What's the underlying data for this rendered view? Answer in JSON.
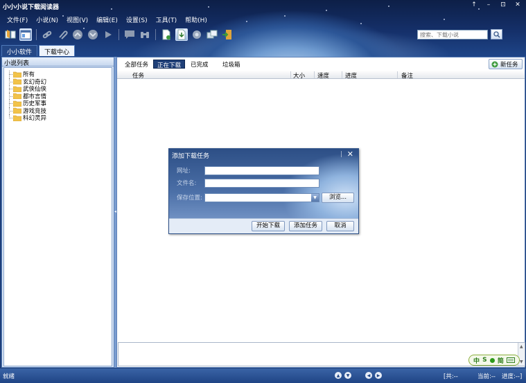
{
  "window": {
    "title": "小小小说下载阅读器",
    "buttons": [
      "↑",
      "–",
      "⊡",
      "✕"
    ]
  },
  "menu": [
    {
      "label": "文件(F)"
    },
    {
      "label": "小说(N)"
    },
    {
      "label": "视图(V)"
    },
    {
      "label": "编辑(E)"
    },
    {
      "label": "设置(S)"
    },
    {
      "label": "工具(T)"
    },
    {
      "label": "帮助(H)"
    }
  ],
  "search": {
    "placeholder": "搜索、下载小说"
  },
  "tabs": [
    {
      "label": "小小软件",
      "selected": false
    },
    {
      "label": "下载中心",
      "selected": true
    }
  ],
  "left_panel": {
    "title": "小说列表",
    "items": [
      "所有",
      "玄幻奇幻",
      "武侠仙侠",
      "都市言情",
      "历史军事",
      "游戏竞技",
      "科幻灵异"
    ]
  },
  "filters": [
    {
      "label": "全部任务",
      "active": false
    },
    {
      "label": "正在下载",
      "active": true
    },
    {
      "label": "已完成",
      "active": false
    },
    {
      "label": "垃圾箱",
      "active": false
    }
  ],
  "new_task_label": "新任务",
  "columns": [
    "任务",
    "大小",
    "速度",
    "进度",
    "备注"
  ],
  "dialog": {
    "title": "添加下载任务",
    "url_label": "网址:",
    "filename_label": "文件名:",
    "save_label": "保存位置:",
    "browse_label": "浏览...",
    "start_label": "开始下载",
    "add_label": "添加任务",
    "cancel_label": "取消"
  },
  "ime": {
    "left": "中",
    "mid": "S",
    "right": "简"
  },
  "status": {
    "left": "就绪",
    "total": "[共:--",
    "current": "当前:--",
    "progress": "进度:--]"
  },
  "colors": {
    "accent": "#1f3f78",
    "status_bg": "#2d55a0"
  }
}
